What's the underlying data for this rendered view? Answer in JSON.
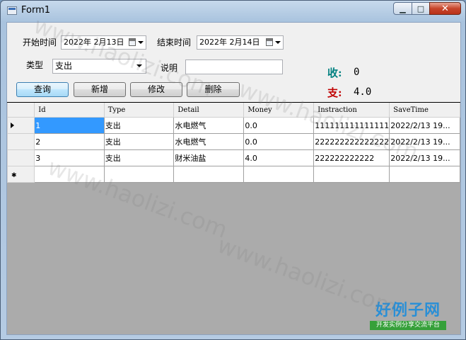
{
  "window": {
    "title": "Form1"
  },
  "filters": {
    "start_label": "开始时间",
    "start_value": "2022年  2月13日",
    "end_label": "结束时间",
    "end_value": "2022年  2月14日",
    "type_label": "类型",
    "type_value": "支出",
    "desc_label": "说明",
    "desc_value": ""
  },
  "buttons": {
    "query": "查询",
    "add": "新增",
    "edit": "修改",
    "delete": "删除"
  },
  "summary": {
    "income_label": "收:",
    "income_value": "0",
    "expense_label": "支:",
    "expense_value": "4.0"
  },
  "colors": {
    "income": "#008080",
    "expense": "#c00000"
  },
  "grid": {
    "columns": [
      "Id",
      "Type",
      "Detail",
      "Money",
      "Instraction",
      "SaveTime"
    ],
    "rows": [
      [
        "1",
        "支出",
        "水电燃气",
        "0.0",
        "111111111111111",
        "2022/2/13 19..."
      ],
      [
        "2",
        "支出",
        "水电燃气",
        "0.0",
        "222222222222222",
        "2022/2/13 19..."
      ],
      [
        "3",
        "支出",
        "财米油盐",
        "4.0",
        "222222222222",
        "2022/2/13 19..."
      ]
    ]
  },
  "watermark": {
    "text": "www.haolizi.com",
    "logo_main": "好例子网",
    "logo_sub": "开发实例分享交流平台"
  }
}
